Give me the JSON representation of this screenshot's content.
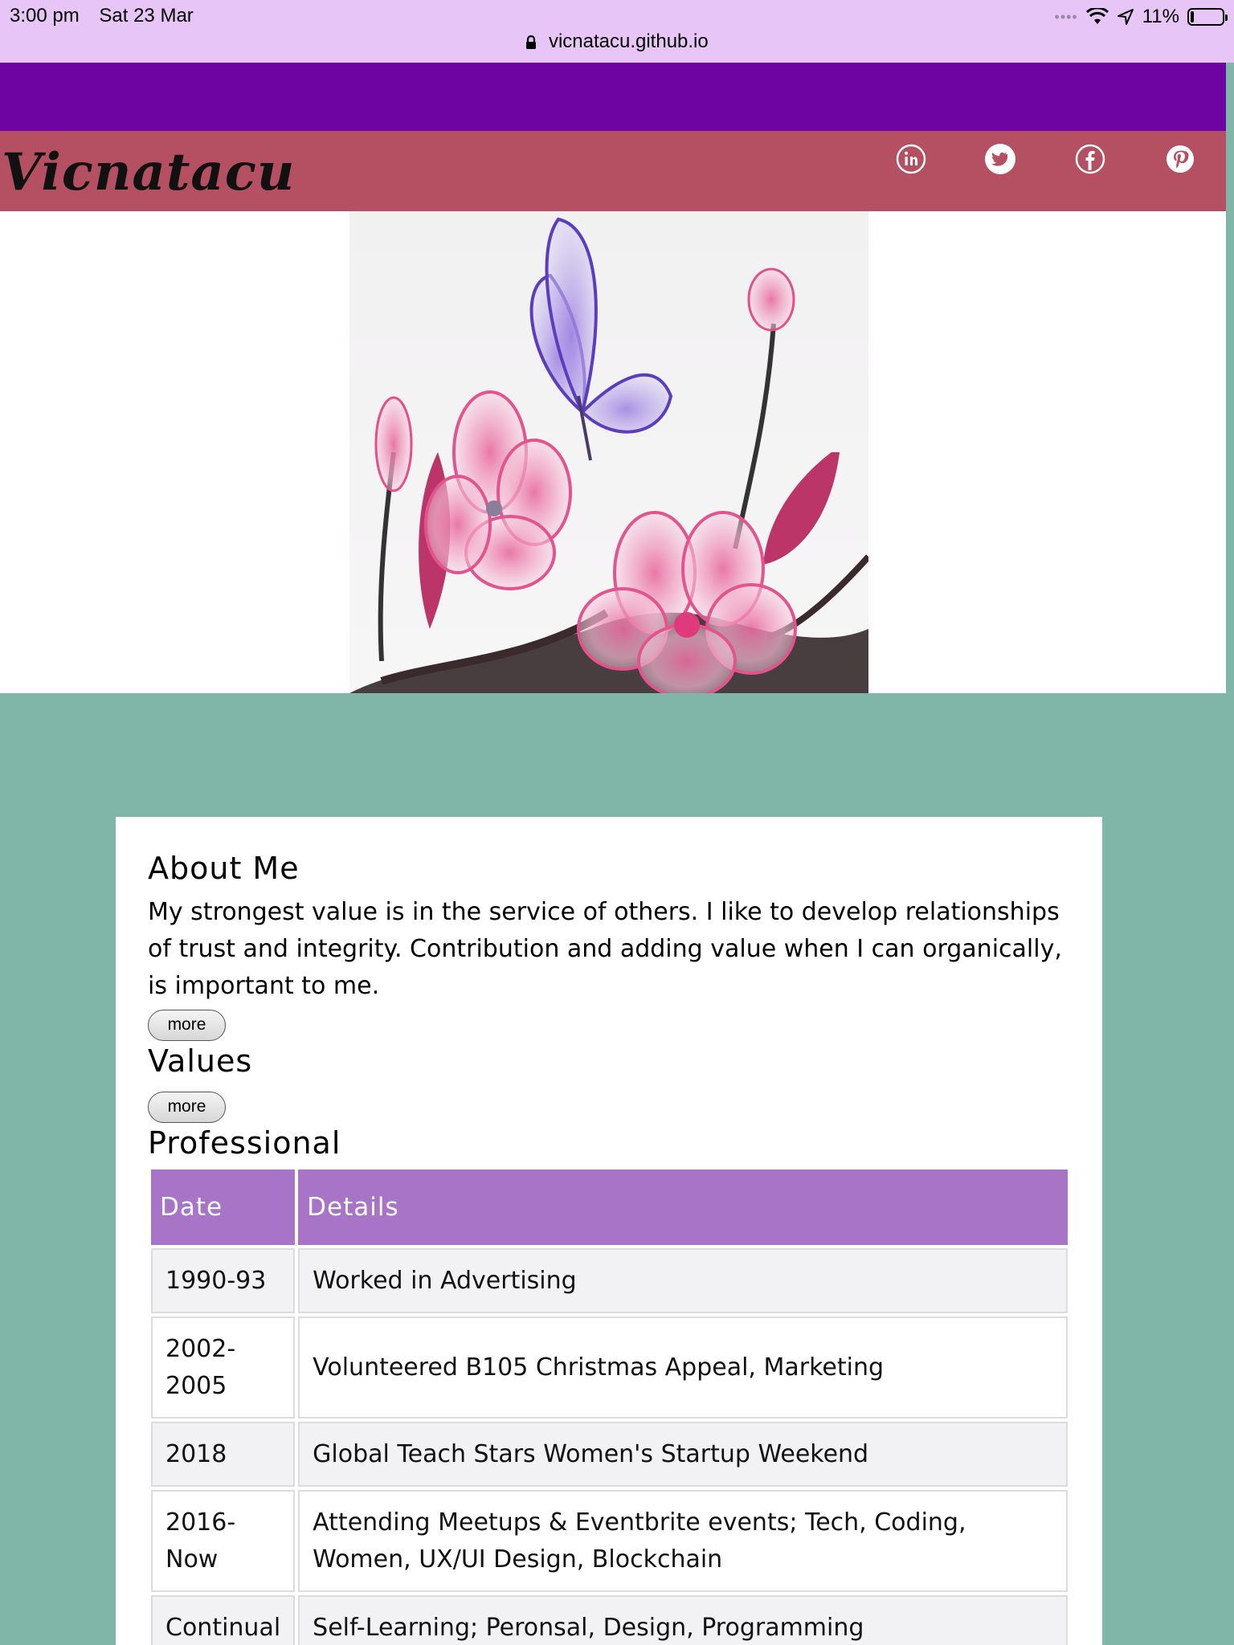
{
  "status_bar": {
    "time": "3:00 pm",
    "date": "Sat 23 Mar",
    "battery": "11%",
    "battery_level": 0.11,
    "url": "vicnatacu.github.io"
  },
  "site": {
    "brand": "Vicnatacu",
    "colors": {
      "purple_band": "#6e04a1",
      "brand_bar": "#b54f62",
      "page_bg": "#80b6a8",
      "table_header": "#a874c8"
    },
    "social_icons": [
      "linkedin-icon",
      "twitter-icon",
      "facebook-icon",
      "pinterest-icon"
    ]
  },
  "about": {
    "title": "About Me",
    "text": "My strongest value is in the service of others. I like to develop relationships of trust and integrity. Contribution and adding value when I can organically, is important to me.",
    "more": "more"
  },
  "values": {
    "title": "Values",
    "more": "more"
  },
  "professional": {
    "title": "Professional",
    "headers": {
      "date": "Date",
      "details": "Details"
    },
    "rows": [
      {
        "date": "1990-93",
        "details": "Worked in Advertising"
      },
      {
        "date": "2002-2005",
        "details": "Volunteered B105 Christmas Appeal, Marketing"
      },
      {
        "date": "2018",
        "details": "Global Teach Stars Women's Startup Weekend"
      },
      {
        "date": "2016-Now",
        "details": "Attending Meetups & Eventbrite events; Tech, Coding, Women, UX/UI Design, Blockchain"
      },
      {
        "date": "Continual",
        "details": "Self-Learning; Peronsal, Design, Programming"
      }
    ]
  }
}
